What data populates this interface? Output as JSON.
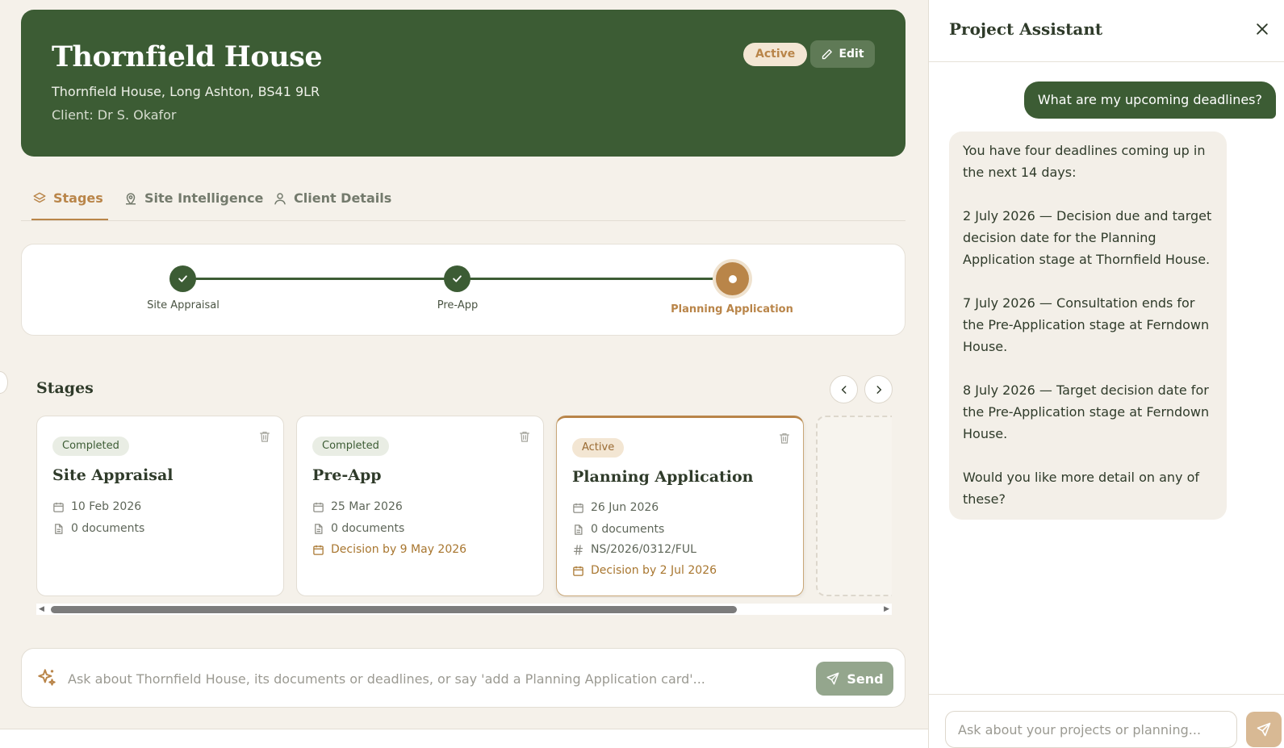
{
  "project": {
    "title": "Thornfield House",
    "address": "Thornfield House, Long Ashton, BS41 9LR",
    "client": "Client: Dr S. Okafor",
    "status": "Active",
    "edit_label": "Edit"
  },
  "tabs": [
    {
      "label": "Stages",
      "icon": "layers-icon",
      "active": true
    },
    {
      "label": "Site Intelligence",
      "icon": "map-pin-icon",
      "active": false
    },
    {
      "label": "Client Details",
      "icon": "user-icon",
      "active": false
    }
  ],
  "progress": [
    {
      "label": "Site Appraisal",
      "state": "completed"
    },
    {
      "label": "Pre-App",
      "state": "completed"
    },
    {
      "label": "Planning Application",
      "state": "current"
    }
  ],
  "stages_section": {
    "heading": "Stages",
    "cards": [
      {
        "status": "Completed",
        "title": "Site Appraisal",
        "date": "10 Feb 2026",
        "documents": "0 documents"
      },
      {
        "status": "Completed",
        "title": "Pre-App",
        "date": "25 Mar 2026",
        "documents": "0 documents",
        "deadline": "Decision by 9 May 2026"
      },
      {
        "status": "Active",
        "title": "Planning Application",
        "date": "26 Jun 2026",
        "documents": "0 documents",
        "reference": "NS/2026/0312/FUL",
        "deadline": "Decision by 2 Jul 2026"
      }
    ]
  },
  "askbar": {
    "placeholder": "Ask about Thornfield House, its documents or deadlines, or say 'add a Planning Application card'...",
    "send_label": "Send"
  },
  "assistant": {
    "title": "Project Assistant",
    "user_message": "What are my upcoming deadlines?",
    "bot_paragraphs": [
      "You have four deadlines coming up in the next 14 days:",
      "2 July 2026 — Decision due and target decision date for the Planning Application stage at Thornfield House.",
      "7 July 2026 — Consultation ends for the Pre-Application stage at Ferndown House.",
      "8 July 2026 — Target decision date for the Pre-Application stage at Ferndown House.",
      "Would you like more detail on any of these?"
    ],
    "input_placeholder": "Ask about your projects or planning..."
  },
  "colors": {
    "primary": "#3c5c34",
    "accent": "#b98549",
    "background": "#f5f1ea"
  }
}
